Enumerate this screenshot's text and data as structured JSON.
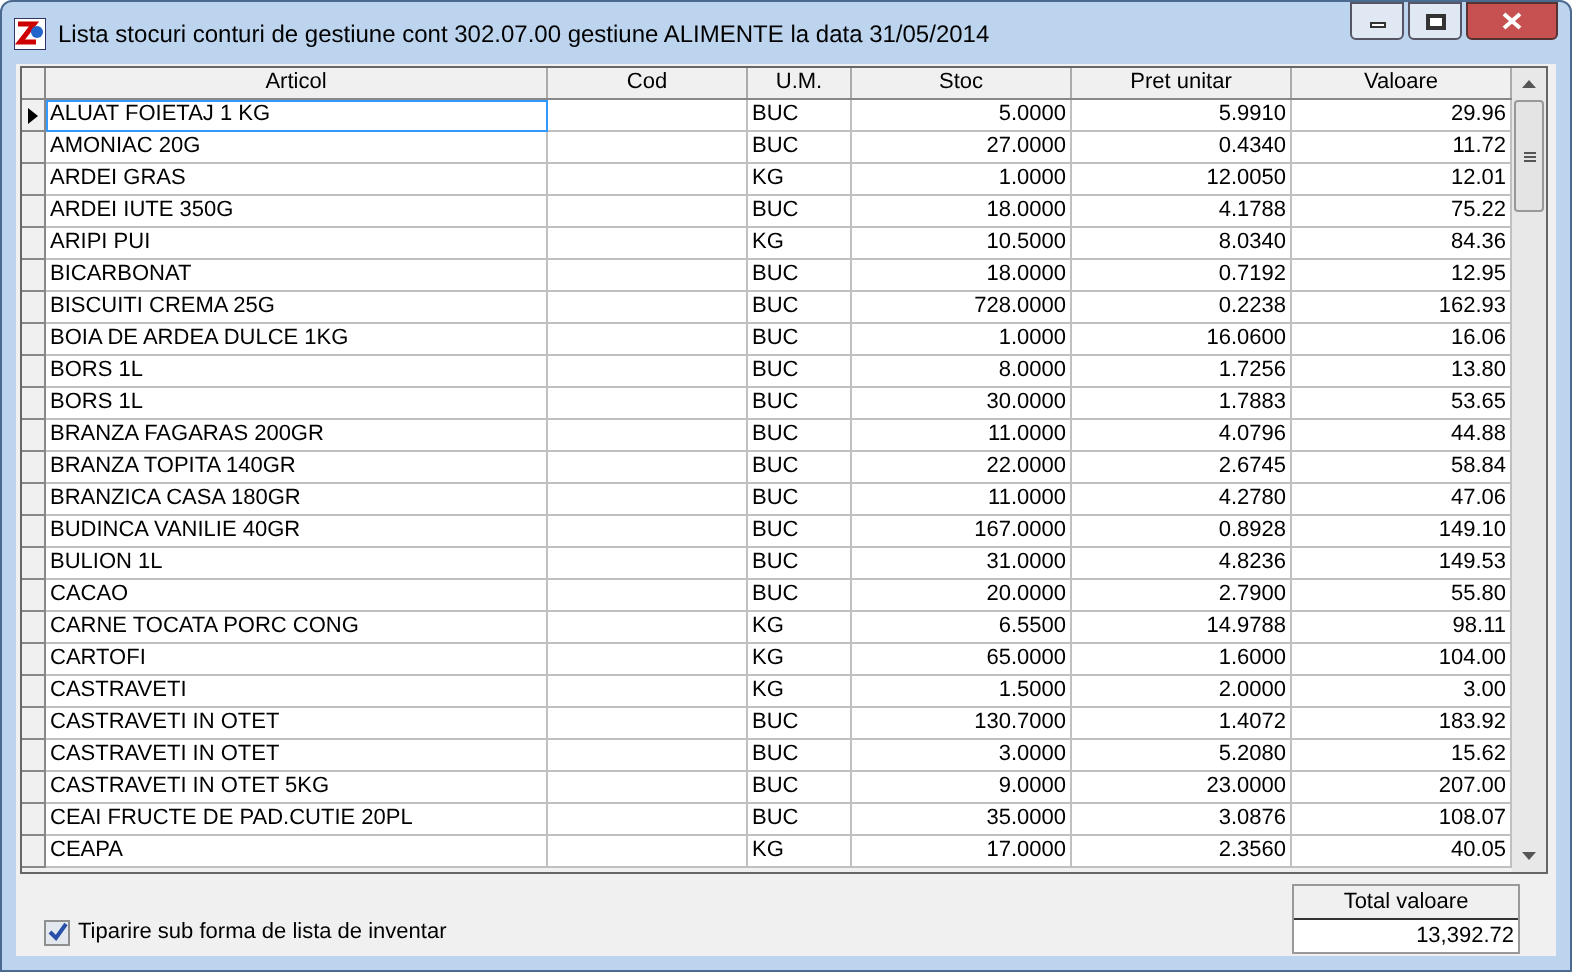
{
  "window": {
    "title": "Lista stocuri conturi de gestiune cont 302.07.00 gestiune ALIMENTE la data 31/05/2014"
  },
  "grid": {
    "columns": [
      "Articol",
      "Cod",
      "U.M.",
      "Stoc",
      "Pret unitar",
      "Valoare"
    ],
    "rows": [
      {
        "articol": "ALUAT FOIETAJ 1 KG",
        "um": "BUC",
        "stoc": "5.0000",
        "pret": "5.9910",
        "valoare": "29.96",
        "selected": true
      },
      {
        "articol": "AMONIAC 20G",
        "um": "BUC",
        "stoc": "27.0000",
        "pret": "0.4340",
        "valoare": "11.72",
        "selected": false
      },
      {
        "articol": "ARDEI GRAS",
        "um": "KG",
        "stoc": "1.0000",
        "pret": "12.0050",
        "valoare": "12.01",
        "selected": false
      },
      {
        "articol": "ARDEI IUTE 350G",
        "um": "BUC",
        "stoc": "18.0000",
        "pret": "4.1788",
        "valoare": "75.22",
        "selected": false
      },
      {
        "articol": "ARIPI PUI",
        "um": "KG",
        "stoc": "10.5000",
        "pret": "8.0340",
        "valoare": "84.36",
        "selected": false
      },
      {
        "articol": "BICARBONAT",
        "um": "BUC",
        "stoc": "18.0000",
        "pret": "0.7192",
        "valoare": "12.95",
        "selected": false
      },
      {
        "articol": "BISCUITI CREMA 25G",
        "um": "BUC",
        "stoc": "728.0000",
        "pret": "0.2238",
        "valoare": "162.93",
        "selected": false
      },
      {
        "articol": "BOIA DE ARDEA DULCE 1KG",
        "um": "BUC",
        "stoc": "1.0000",
        "pret": "16.0600",
        "valoare": "16.06",
        "selected": false
      },
      {
        "articol": "BORS 1L",
        "um": "BUC",
        "stoc": "8.0000",
        "pret": "1.7256",
        "valoare": "13.80",
        "selected": false
      },
      {
        "articol": "BORS 1L",
        "um": "BUC",
        "stoc": "30.0000",
        "pret": "1.7883",
        "valoare": "53.65",
        "selected": false
      },
      {
        "articol": "BRANZA FAGARAS 200GR",
        "um": "BUC",
        "stoc": "11.0000",
        "pret": "4.0796",
        "valoare": "44.88",
        "selected": false
      },
      {
        "articol": "BRANZA TOPITA 140GR",
        "um": "BUC",
        "stoc": "22.0000",
        "pret": "2.6745",
        "valoare": "58.84",
        "selected": false
      },
      {
        "articol": "BRANZICA CASA 180GR",
        "um": "BUC",
        "stoc": "11.0000",
        "pret": "4.2780",
        "valoare": "47.06",
        "selected": false
      },
      {
        "articol": "BUDINCA VANILIE 40GR",
        "um": "BUC",
        "stoc": "167.0000",
        "pret": "0.8928",
        "valoare": "149.10",
        "selected": false
      },
      {
        "articol": "BULION 1L",
        "um": "BUC",
        "stoc": "31.0000",
        "pret": "4.8236",
        "valoare": "149.53",
        "selected": false
      },
      {
        "articol": "CACAO",
        "um": "BUC",
        "stoc": "20.0000",
        "pret": "2.7900",
        "valoare": "55.80",
        "selected": false
      },
      {
        "articol": "CARNE TOCATA PORC CONG",
        "um": "KG",
        "stoc": "6.5500",
        "pret": "14.9788",
        "valoare": "98.11",
        "selected": false
      },
      {
        "articol": "CARTOFI",
        "um": "KG",
        "stoc": "65.0000",
        "pret": "1.6000",
        "valoare": "104.00",
        "selected": false
      },
      {
        "articol": "CASTRAVETI",
        "um": "KG",
        "stoc": "1.5000",
        "pret": "2.0000",
        "valoare": "3.00",
        "selected": false
      },
      {
        "articol": "CASTRAVETI IN OTET",
        "um": "BUC",
        "stoc": "130.7000",
        "pret": "1.4072",
        "valoare": "183.92",
        "selected": false
      },
      {
        "articol": "CASTRAVETI IN OTET",
        "um": "BUC",
        "stoc": "3.0000",
        "pret": "5.2080",
        "valoare": "15.62",
        "selected": false
      },
      {
        "articol": "CASTRAVETI IN OTET 5KG",
        "um": "BUC",
        "stoc": "9.0000",
        "pret": "23.0000",
        "valoare": "207.00",
        "selected": false
      },
      {
        "articol": "CEAI FRUCTE DE PAD.CUTIE 20PL",
        "um": "BUC",
        "stoc": "35.0000",
        "pret": "3.0876",
        "valoare": "108.07",
        "selected": false
      },
      {
        "articol": "CEAPA",
        "um": "KG",
        "stoc": "17.0000",
        "pret": "2.3560",
        "valoare": "40.05",
        "selected": false
      }
    ]
  },
  "print_option": {
    "label": "Tiparire sub forma de lista de inventar",
    "checked": true
  },
  "total": {
    "label": "Total valoare",
    "value": "13,392.72"
  }
}
